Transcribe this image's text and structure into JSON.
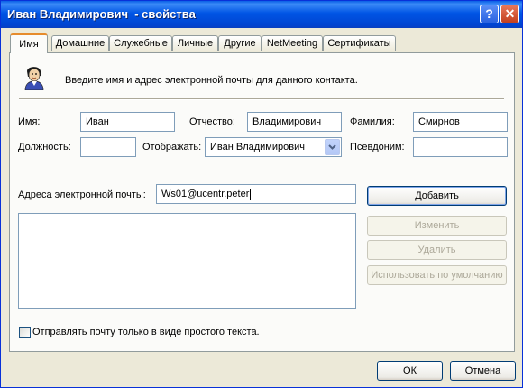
{
  "window": {
    "title": "Иван Владимирович  - свойства",
    "help_label": "?",
    "close_label": "✕"
  },
  "tabs": [
    {
      "label": "Имя",
      "active": true
    },
    {
      "label": "Домашние",
      "active": false
    },
    {
      "label": "Служебные",
      "active": false
    },
    {
      "label": "Личные",
      "active": false
    },
    {
      "label": "Другие",
      "active": false
    },
    {
      "label": "NetMeeting",
      "active": false
    },
    {
      "label": "Сертификаты",
      "active": false
    }
  ],
  "intro": {
    "icon": "contact-person-icon",
    "text": "Введите имя и адрес электронной почты для данного контакта."
  },
  "name_fields": {
    "first_name_label": "Имя:",
    "first_name_value": "Иван",
    "middle_name_label": "Отчество:",
    "middle_name_value": "Владимирович",
    "last_name_label": "Фамилия:",
    "last_name_value": "Смирнов",
    "position_label": "Должность:",
    "position_value": "",
    "display_label": "Отображать:",
    "display_value": "Иван Владимирович",
    "nickname_label": "Псевдоним:",
    "nickname_value": ""
  },
  "email": {
    "label": "Адреса электронной почты:",
    "input_value": "Ws01@ucentr.peter",
    "addresses": [],
    "add_button": "Добавить",
    "edit_button": "Изменить",
    "delete_button": "Удалить",
    "default_button": "Использовать по умолчанию",
    "plain_text_label": "Отправлять почту только в виде простого текста.",
    "plain_text_checked": false
  },
  "footer": {
    "ok_button": "ОК",
    "cancel_button": "Отмена"
  }
}
